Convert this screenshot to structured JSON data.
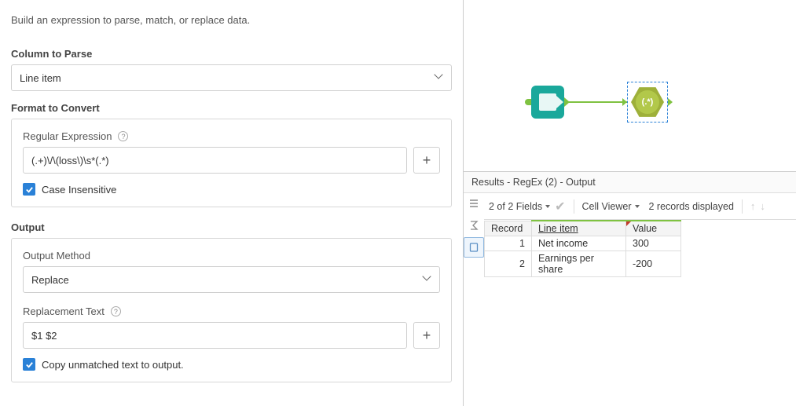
{
  "intro": "Build an expression to parse, match, or replace data.",
  "column_to_parse": {
    "label": "Column to Parse",
    "value": "Line item"
  },
  "format_to_convert": {
    "label": "Format to Convert",
    "regex_label": "Regular Expression",
    "regex_value": "(.+)\\/\\(loss\\)\\s*(.*)",
    "case_insensitive_label": "Case Insensitive"
  },
  "output": {
    "label": "Output",
    "method_label": "Output Method",
    "method_value": "Replace",
    "replacement_label": "Replacement Text",
    "replacement_value": "$1 $2",
    "copy_unmatched_label": "Copy unmatched text to output."
  },
  "canvas": {
    "regex_node_text": "(.*)"
  },
  "results": {
    "title": "Results - RegEx (2) - Output",
    "fields_summary": "2 of 2 Fields",
    "cell_viewer_label": "Cell Viewer",
    "records_displayed": "2 records displayed",
    "headers": {
      "record": "Record",
      "line_item": "Line item",
      "value": "Value"
    },
    "rows": [
      {
        "record": "1",
        "line_item": "Net income",
        "value": "300"
      },
      {
        "record": "2",
        "line_item": "Earnings per share",
        "value": "-200"
      }
    ]
  }
}
